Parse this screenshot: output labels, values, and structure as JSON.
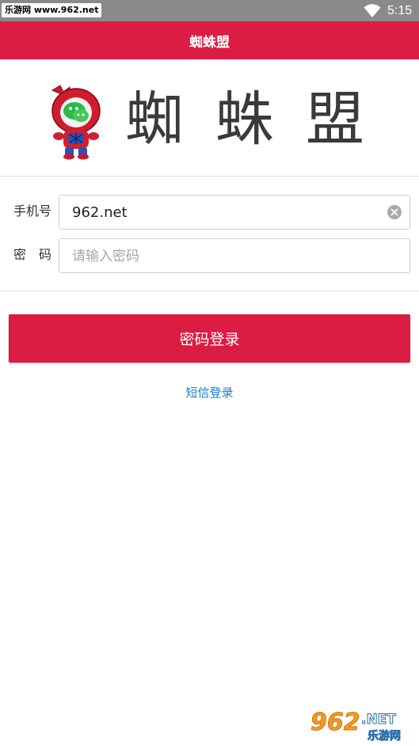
{
  "status_bar": {
    "watermark": "乐游网 www.962.net",
    "time": "5:15",
    "icons": [
      "wifi-icon",
      "battery-icon"
    ]
  },
  "app_bar": {
    "title": "蜘蛛盟"
  },
  "logo": {
    "brand_text": "蜘蛛盟",
    "mascot": "spiderman-mascot"
  },
  "form": {
    "phone": {
      "label": "手机号",
      "value": "962.net"
    },
    "password": {
      "label": "密　码",
      "placeholder": "请输入密码",
      "value": ""
    }
  },
  "actions": {
    "login_label": "密码登录",
    "sms_login_label": "短信登录"
  },
  "watermark_bottom": {
    "main": "962",
    "suffix": ".NET",
    "sub": "乐游网"
  },
  "colors": {
    "accent": "#dc1c43",
    "link": "#1a7bd0",
    "status_bar": "#8a8a8a"
  }
}
